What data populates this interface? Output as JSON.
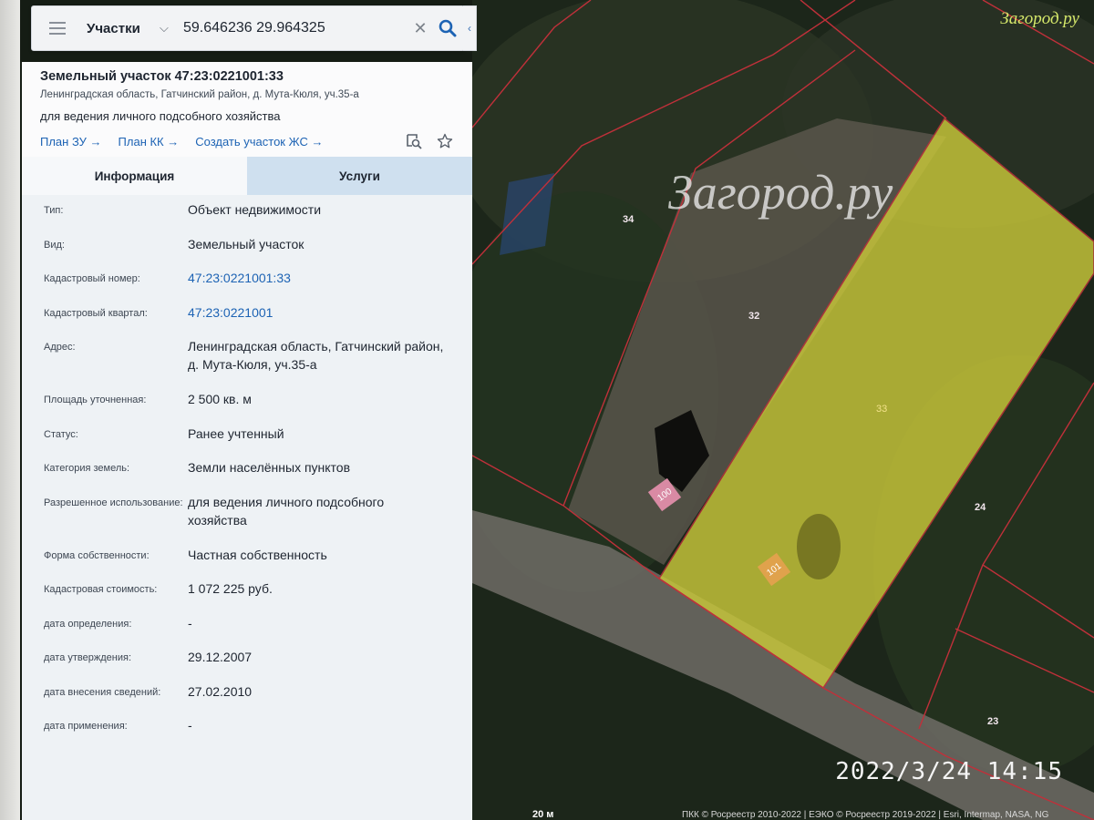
{
  "search": {
    "category": "Участки",
    "query": "59.646236 29.964325"
  },
  "card": {
    "title": "Земельный участок 47:23:0221001:33",
    "address": "Ленинградская область, Гатчинский район, д. Мута-Кюля, уч.35-а",
    "purpose": "для ведения личного подсобного хозяйства",
    "links": [
      "План ЗУ →",
      "План КК →",
      "Создать участок ЖС →"
    ]
  },
  "tabs": [
    "Информация",
    "Услуги"
  ],
  "rows": [
    {
      "k": "Тип:",
      "v": "Объект недвижимости"
    },
    {
      "k": "Вид:",
      "v": "Земельный участок"
    },
    {
      "k": "Кадастровый номер:",
      "v": "47:23:0221001:33"
    },
    {
      "k": "Кадастровый квартал:",
      "v": "47:23:0221001"
    },
    {
      "k": "Адрес:",
      "v": "Ленинградская область, Гатчинский район, д. Мута-Кюля, уч.35-а"
    },
    {
      "k": "Площадь уточненная:",
      "v": "2 500 кв. м"
    },
    {
      "k": "Статус:",
      "v": "Ранее учтенный"
    },
    {
      "k": "Категория земель:",
      "v": "Земли населённых пунктов"
    },
    {
      "k": "Разрешенное использование:",
      "v": "для ведения личного подсобного хозяйства"
    },
    {
      "k": "Форма собственности:",
      "v": "Частная собственность"
    },
    {
      "k": "Кадастровая стоимость:",
      "v": "1 072 225 руб."
    },
    {
      "k": "дата определения:",
      "v": "-"
    },
    {
      "k": "дата утверждения:",
      "v": "29.12.2007"
    },
    {
      "k": "дата внесения сведений:",
      "v": "27.02.2010"
    },
    {
      "k": "дата применения:",
      "v": "-"
    }
  ],
  "map": {
    "lots": [
      "34",
      "32",
      "33",
      "24",
      "23"
    ],
    "buildings": [
      "100",
      "101"
    ],
    "watermark": "Загород.ру",
    "brand": "Загород.ру",
    "scale": "20 м",
    "attribution": "ПКК © Росреестр 2010-2022 | ЕЭКО © Росреестр 2019-2022 | Esri, Intermap, NASA, NG",
    "photo_timestamp": "2022/3/24  14:15",
    "highlight_color": "#c9c83a",
    "boundary_color": "#c0303a"
  }
}
